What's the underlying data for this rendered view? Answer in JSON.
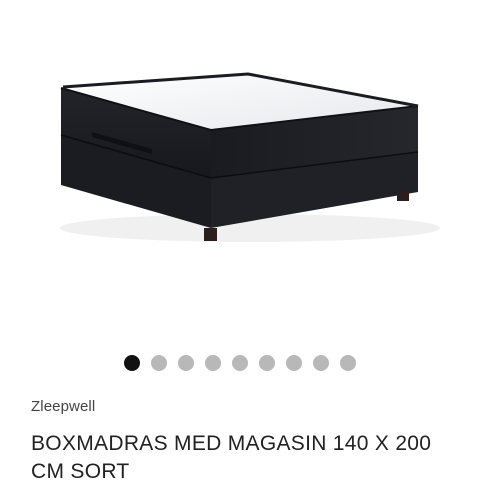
{
  "gallery": {
    "image_subject": "black boxspring bed with storage drawer",
    "active_index": 0,
    "total_images": 9
  },
  "product": {
    "brand": "Zleepwell",
    "title": "BOXMADRAS MED MAGASIN 140 X 200 CM SORT"
  },
  "colors": {
    "active_dot": "#111111",
    "inactive_dot": "#b8b8b8",
    "bed_fabric": "#1c1d22",
    "mattress_top": "#f2f3f5"
  }
}
